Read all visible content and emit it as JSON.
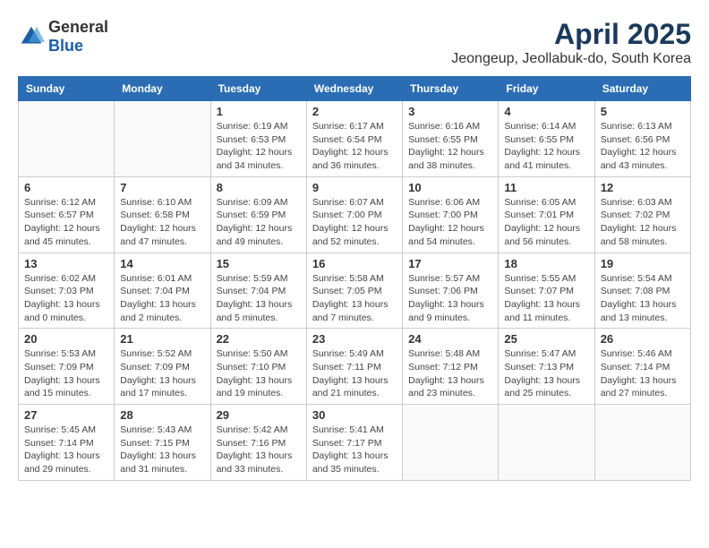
{
  "header": {
    "logo_general": "General",
    "logo_blue": "Blue",
    "title": "April 2025",
    "subtitle": "Jeongeup, Jeollabuk-do, South Korea"
  },
  "days_of_week": [
    "Sunday",
    "Monday",
    "Tuesday",
    "Wednesday",
    "Thursday",
    "Friday",
    "Saturday"
  ],
  "weeks": [
    [
      {
        "day": "",
        "info": ""
      },
      {
        "day": "",
        "info": ""
      },
      {
        "day": "1",
        "info": "Sunrise: 6:19 AM\nSunset: 6:53 PM\nDaylight: 12 hours and 34 minutes."
      },
      {
        "day": "2",
        "info": "Sunrise: 6:17 AM\nSunset: 6:54 PM\nDaylight: 12 hours and 36 minutes."
      },
      {
        "day": "3",
        "info": "Sunrise: 6:16 AM\nSunset: 6:55 PM\nDaylight: 12 hours and 38 minutes."
      },
      {
        "day": "4",
        "info": "Sunrise: 6:14 AM\nSunset: 6:55 PM\nDaylight: 12 hours and 41 minutes."
      },
      {
        "day": "5",
        "info": "Sunrise: 6:13 AM\nSunset: 6:56 PM\nDaylight: 12 hours and 43 minutes."
      }
    ],
    [
      {
        "day": "6",
        "info": "Sunrise: 6:12 AM\nSunset: 6:57 PM\nDaylight: 12 hours and 45 minutes."
      },
      {
        "day": "7",
        "info": "Sunrise: 6:10 AM\nSunset: 6:58 PM\nDaylight: 12 hours and 47 minutes."
      },
      {
        "day": "8",
        "info": "Sunrise: 6:09 AM\nSunset: 6:59 PM\nDaylight: 12 hours and 49 minutes."
      },
      {
        "day": "9",
        "info": "Sunrise: 6:07 AM\nSunset: 7:00 PM\nDaylight: 12 hours and 52 minutes."
      },
      {
        "day": "10",
        "info": "Sunrise: 6:06 AM\nSunset: 7:00 PM\nDaylight: 12 hours and 54 minutes."
      },
      {
        "day": "11",
        "info": "Sunrise: 6:05 AM\nSunset: 7:01 PM\nDaylight: 12 hours and 56 minutes."
      },
      {
        "day": "12",
        "info": "Sunrise: 6:03 AM\nSunset: 7:02 PM\nDaylight: 12 hours and 58 minutes."
      }
    ],
    [
      {
        "day": "13",
        "info": "Sunrise: 6:02 AM\nSunset: 7:03 PM\nDaylight: 13 hours and 0 minutes."
      },
      {
        "day": "14",
        "info": "Sunrise: 6:01 AM\nSunset: 7:04 PM\nDaylight: 13 hours and 2 minutes."
      },
      {
        "day": "15",
        "info": "Sunrise: 5:59 AM\nSunset: 7:04 PM\nDaylight: 13 hours and 5 minutes."
      },
      {
        "day": "16",
        "info": "Sunrise: 5:58 AM\nSunset: 7:05 PM\nDaylight: 13 hours and 7 minutes."
      },
      {
        "day": "17",
        "info": "Sunrise: 5:57 AM\nSunset: 7:06 PM\nDaylight: 13 hours and 9 minutes."
      },
      {
        "day": "18",
        "info": "Sunrise: 5:55 AM\nSunset: 7:07 PM\nDaylight: 13 hours and 11 minutes."
      },
      {
        "day": "19",
        "info": "Sunrise: 5:54 AM\nSunset: 7:08 PM\nDaylight: 13 hours and 13 minutes."
      }
    ],
    [
      {
        "day": "20",
        "info": "Sunrise: 5:53 AM\nSunset: 7:09 PM\nDaylight: 13 hours and 15 minutes."
      },
      {
        "day": "21",
        "info": "Sunrise: 5:52 AM\nSunset: 7:09 PM\nDaylight: 13 hours and 17 minutes."
      },
      {
        "day": "22",
        "info": "Sunrise: 5:50 AM\nSunset: 7:10 PM\nDaylight: 13 hours and 19 minutes."
      },
      {
        "day": "23",
        "info": "Sunrise: 5:49 AM\nSunset: 7:11 PM\nDaylight: 13 hours and 21 minutes."
      },
      {
        "day": "24",
        "info": "Sunrise: 5:48 AM\nSunset: 7:12 PM\nDaylight: 13 hours and 23 minutes."
      },
      {
        "day": "25",
        "info": "Sunrise: 5:47 AM\nSunset: 7:13 PM\nDaylight: 13 hours and 25 minutes."
      },
      {
        "day": "26",
        "info": "Sunrise: 5:46 AM\nSunset: 7:14 PM\nDaylight: 13 hours and 27 minutes."
      }
    ],
    [
      {
        "day": "27",
        "info": "Sunrise: 5:45 AM\nSunset: 7:14 PM\nDaylight: 13 hours and 29 minutes."
      },
      {
        "day": "28",
        "info": "Sunrise: 5:43 AM\nSunset: 7:15 PM\nDaylight: 13 hours and 31 minutes."
      },
      {
        "day": "29",
        "info": "Sunrise: 5:42 AM\nSunset: 7:16 PM\nDaylight: 13 hours and 33 minutes."
      },
      {
        "day": "30",
        "info": "Sunrise: 5:41 AM\nSunset: 7:17 PM\nDaylight: 13 hours and 35 minutes."
      },
      {
        "day": "",
        "info": ""
      },
      {
        "day": "",
        "info": ""
      },
      {
        "day": "",
        "info": ""
      }
    ]
  ]
}
